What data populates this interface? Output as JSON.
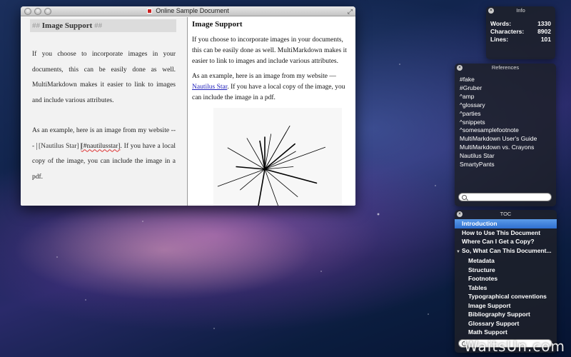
{
  "window": {
    "title": "Online Sample Document"
  },
  "editor": {
    "heading": {
      "hash_open": "##",
      "text": "Image Support",
      "hash_close": "##"
    },
    "para1": "If you choose to incorporate images in your documents, this can be easily done as well. MultiMarkdown makes it easier to link to images and include various attributes.",
    "para2_before": "As an example, here is an image from my website --- ",
    "para2_link": "[Nautilus Star]",
    "para2_ref": "[#nautilusstar]",
    "para2_after": ". If you have a local copy of the image, you can include the image in a pdf."
  },
  "preview": {
    "heading": "Image Support",
    "para1": "If you choose to incorporate images in your documents, this can be easily done as well. MultiMarkdown makes it easier to link to images and include various attributes.",
    "para2_before": "As an example, here is an image from my website — ",
    "para2_link": "Nautilus Star",
    "para2_after": ". If you have a local copy of the image, you can include the image in a pdf."
  },
  "info": {
    "title": "Info",
    "rows": [
      {
        "label": "Words:",
        "value": "1330"
      },
      {
        "label": "Characters:",
        "value": "8902"
      },
      {
        "label": "Lines:",
        "value": "101"
      }
    ]
  },
  "references": {
    "title": "References",
    "items": [
      "#fake",
      "#Gruber",
      "^amp",
      "^glossary",
      "^parties",
      "^snippets",
      "^somesamplefootnote",
      "MultiMarkdown User's Guide",
      "MultiMarkdown vs. Crayons",
      "Nautilus Star",
      "SmartyPants"
    ]
  },
  "toc": {
    "title": "TOC",
    "items": [
      {
        "label": "Introduction",
        "level": 1,
        "active": true
      },
      {
        "label": "How to Use This Document",
        "level": 1
      },
      {
        "label": "Where Can I Get a Copy?",
        "level": 1
      },
      {
        "label": "So, What Can This Document...",
        "level": 1,
        "expanded": true
      },
      {
        "label": "Metadata",
        "level": 2
      },
      {
        "label": "Structure",
        "level": 2
      },
      {
        "label": "Footnotes",
        "level": 2
      },
      {
        "label": "Tables",
        "level": 2
      },
      {
        "label": "Typographical conventions",
        "level": 2
      },
      {
        "label": "Image Support",
        "level": 2
      },
      {
        "label": "Bibliography Support",
        "level": 2
      },
      {
        "label": "Glossary Support",
        "level": 2
      },
      {
        "label": "Math Support",
        "level": 2
      }
    ]
  },
  "watermark": "WaitsUn.com"
}
